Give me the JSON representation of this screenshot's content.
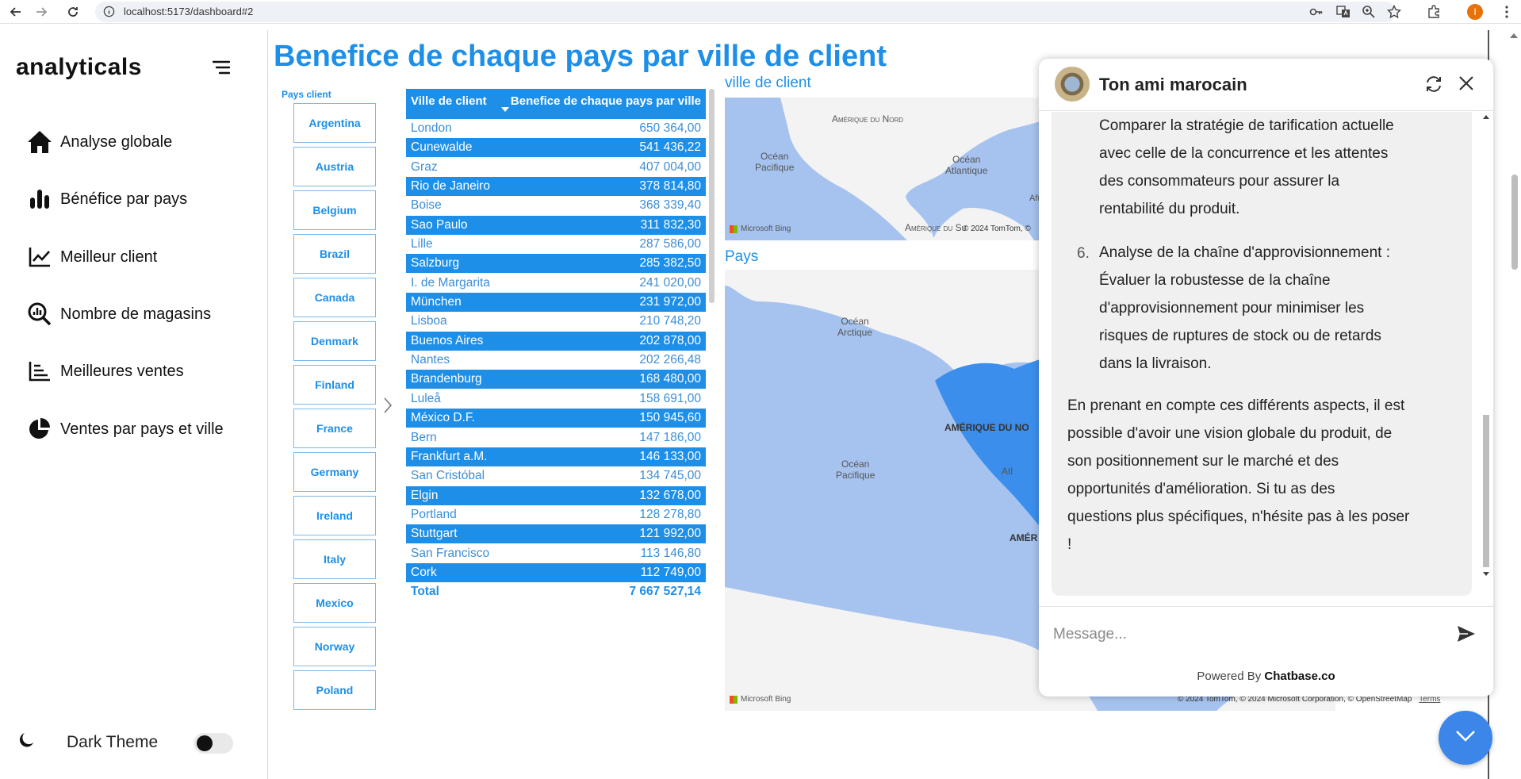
{
  "browser": {
    "url": "localhost:5173/dashboard#2",
    "profile_initial": "I"
  },
  "sidebar": {
    "brand": "analyticals",
    "items": [
      {
        "label": "Analyse globale",
        "icon": "home-icon"
      },
      {
        "label": "Bénéfice par pays",
        "icon": "bar-chart-icon"
      },
      {
        "label": "Meilleur client",
        "icon": "line-chart-icon"
      },
      {
        "label": "Nombre de magasins",
        "icon": "search-analytics-icon"
      },
      {
        "label": "Meilleures ventes",
        "icon": "sorted-bars-icon"
      },
      {
        "label": "Ventes par pays et ville",
        "icon": "pie-chart-icon"
      }
    ],
    "theme_label": "Dark Theme",
    "theme_on": false
  },
  "main": {
    "title": "Benefice de chaque pays par ville de client",
    "slicer": {
      "title": "Pays client",
      "items": [
        "Argentina",
        "Austria",
        "Belgium",
        "Brazil",
        "Canada",
        "Denmark",
        "Finland",
        "France",
        "Germany",
        "Ireland",
        "Italy",
        "Mexico",
        "Norway",
        "Poland"
      ]
    },
    "table": {
      "col1": "Ville de client",
      "col2": "Benefice de chaque pays par ville",
      "rows": [
        [
          "London",
          "650 364,00"
        ],
        [
          "Cunewalde",
          "541 436,22"
        ],
        [
          "Graz",
          "407 004,00"
        ],
        [
          "Rio de Janeiro",
          "378 814,80"
        ],
        [
          "Boise",
          "368 339,40"
        ],
        [
          "Sao Paulo",
          "311 832,30"
        ],
        [
          "Lille",
          "287 586,00"
        ],
        [
          "Salzburg",
          "285 382,50"
        ],
        [
          "I. de Margarita",
          "241 020,00"
        ],
        [
          "München",
          "231 972,00"
        ],
        [
          "Lisboa",
          "210 748,20"
        ],
        [
          "Buenos Aires",
          "202 878,00"
        ],
        [
          "Nantes",
          "202 266,48"
        ],
        [
          "Brandenburg",
          "168 480,00"
        ],
        [
          "Luleå",
          "158 691,00"
        ],
        [
          "México D.F.",
          "150 945,60"
        ],
        [
          "Bern",
          "147 186,00"
        ],
        [
          "Frankfurt a.M.",
          "146 133,00"
        ],
        [
          "San Cristóbal",
          "134 745,00"
        ],
        [
          "Elgin",
          "132 678,00"
        ],
        [
          "Portland",
          "128 278,80"
        ],
        [
          "Stuttgart",
          "121 992,00"
        ],
        [
          "San Francisco",
          "113 146,80"
        ],
        [
          "Cork",
          "112 749,00"
        ]
      ],
      "total_label": "Total",
      "total_value": "7 667 527,14"
    },
    "map1": {
      "label": "ville de client",
      "north_america": "Amérique du Nord",
      "pacific": "Océan\nPacifique",
      "atlantic": "Océan\nAtlantique",
      "south_america": "Amérique du Su",
      "africa": "Afri",
      "bing": "Microsoft Bing",
      "copyright": "© 2024 TomTom, ©"
    },
    "map2": {
      "label": "Pays",
      "arctic": "Océan\nArctique",
      "north_america": "AMÉRIQUE DU NO",
      "pacific": "Océan\nPacifique",
      "atl": "Atl",
      "south": "AMÉR",
      "bing": "Microsoft Bing",
      "copyright": "© 2024 TomTom, © 2024 Microsoft Corporation, © OpenStreetMap",
      "terms": "Terms"
    }
  },
  "chat": {
    "name": "Ton ami marocain",
    "p1_lines": [
      "Comparer la stratégie de tarification actuelle",
      "avec celle de la concurrence et les attentes",
      "des consommateurs pour assurer la",
      "rentabilité du produit."
    ],
    "item_number": "6.",
    "p2_lines": [
      "Analyse de la chaîne d'approvisionnement :",
      "Évaluer la robustesse de la chaîne",
      "d'approvisionnement pour minimiser les",
      "risques de ruptures de stock ou de retards",
      "dans la livraison."
    ],
    "p3_lines": [
      "En prenant en compte ces différents aspects, il est",
      "possible d'avoir une vision globale du produit, de",
      "son positionnement sur le marché et des",
      "opportunités d'amélioration. Si tu as des",
      "questions plus spécifiques, n'hésite pas à les poser",
      "!"
    ],
    "input_placeholder": "Message...",
    "powered_prefix": "Powered By",
    "powered_brand": "Chatbase.co"
  },
  "colors": {
    "accent": "#1e8fe8",
    "map_land": "#f3f3f3",
    "map_water": "#a6c3ef",
    "fab": "#3b86e8"
  }
}
